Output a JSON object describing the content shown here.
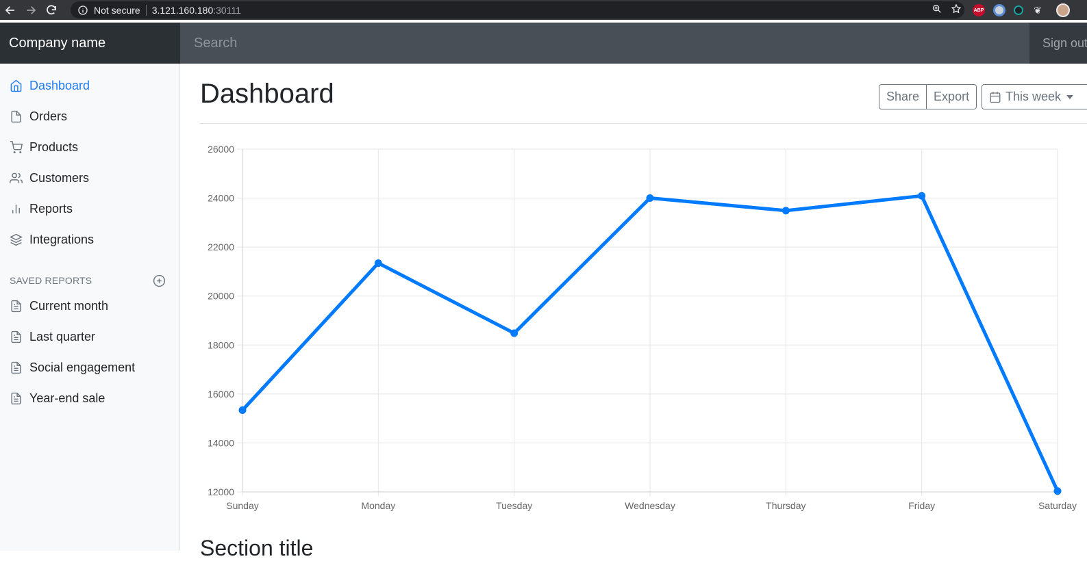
{
  "browser": {
    "security_label": "Not secure",
    "url_host": "3.121.160.180",
    "url_port": ":30111"
  },
  "app": {
    "brand": "Company name",
    "search_placeholder": "Search",
    "signout_label": "Sign out"
  },
  "sidebar": {
    "items": [
      {
        "label": "Dashboard",
        "icon": "home-icon",
        "active": true
      },
      {
        "label": "Orders",
        "icon": "file-icon"
      },
      {
        "label": "Products",
        "icon": "shopping-cart-icon"
      },
      {
        "label": "Customers",
        "icon": "users-icon"
      },
      {
        "label": "Reports",
        "icon": "bar-chart-icon"
      },
      {
        "label": "Integrations",
        "icon": "layers-icon"
      }
    ],
    "saved_heading": "Saved reports",
    "saved_items": [
      {
        "label": "Current month",
        "icon": "file-text-icon"
      },
      {
        "label": "Last quarter",
        "icon": "file-text-icon"
      },
      {
        "label": "Social engagement",
        "icon": "file-text-icon"
      },
      {
        "label": "Year-end sale",
        "icon": "file-text-icon"
      }
    ]
  },
  "main": {
    "title": "Dashboard",
    "share_label": "Share",
    "export_label": "Export",
    "period_label": "This week",
    "section_title": "Section title"
  },
  "colors": {
    "accent": "#007bff",
    "navbar": "#343a40"
  },
  "chart_data": {
    "type": "line",
    "categories": [
      "Sunday",
      "Monday",
      "Tuesday",
      "Wednesday",
      "Thursday",
      "Friday",
      "Saturday"
    ],
    "values": [
      15339,
      21345,
      18483,
      24003,
      23489,
      24092,
      12034
    ],
    "ylim": [
      12000,
      26000
    ],
    "yticks": [
      12000,
      14000,
      16000,
      18000,
      20000,
      22000,
      24000,
      26000
    ],
    "grid": true,
    "legend": "none"
  }
}
